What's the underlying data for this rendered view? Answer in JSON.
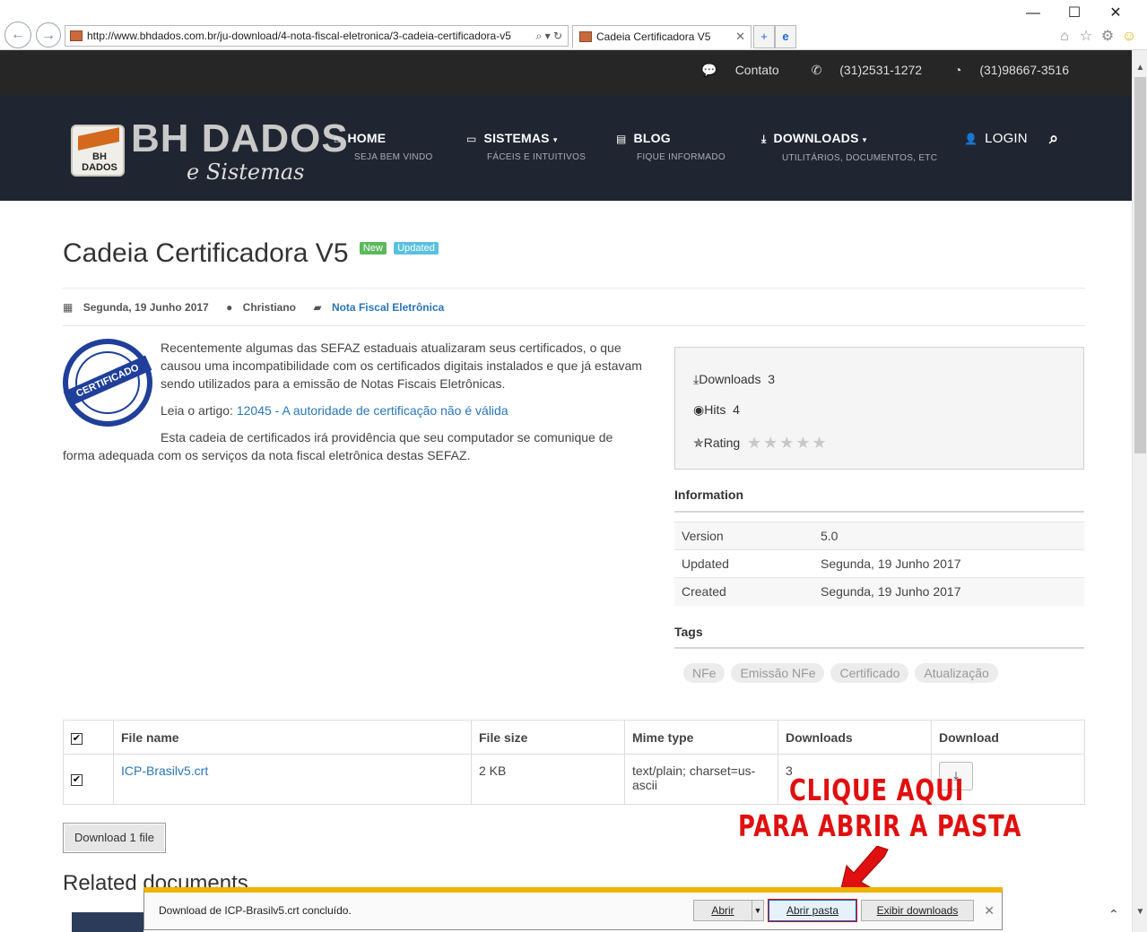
{
  "browser": {
    "url": "http://www.bhdados.com.br/ju-download/4-nota-fiscal-eletronica/3-cadeia-certificadora-v5",
    "tab_title": "Cadeia Certificadora V5",
    "minimize": "—",
    "maximize": "☐",
    "close": "✕"
  },
  "topbar": {
    "contact": "Contato",
    "phone": "(31)2531-1272",
    "whatsapp": "(31)98667-3516"
  },
  "logo": {
    "main": "BH DADOS",
    "sub": "e Sistemas",
    "badge": "BH DADOS"
  },
  "menu": [
    {
      "label": "HOME",
      "sub": "SEJA BEM VINDO",
      "icon": "home-icon"
    },
    {
      "label": "SISTEMAS",
      "sub": "FÁCEIS E INTUITIVOS",
      "icon": "laptop-icon"
    },
    {
      "label": "BLOG",
      "sub": "FIQUE INFORMADO",
      "icon": "newspaper-icon"
    },
    {
      "label": "DOWNLOADS",
      "sub": "UTILITÁRIOS, DOCUMENTOS, ETC",
      "icon": "download-icon"
    },
    {
      "label": "LOGIN",
      "sub": "",
      "icon": "user-icon"
    }
  ],
  "article": {
    "title": "Cadeia Certificadora V5",
    "badge_new": "New",
    "badge_updated": "Updated",
    "date": "Segunda, 19 Junho 2017",
    "author": "Christiano",
    "category": "Nota Fiscal Eletrônica",
    "seal_text": "CERTIFICADO",
    "para1": "Recentemente algumas das SEFAZ estaduais atualizaram seus certificados, o que causou uma incompatibilidade com os certificados digitais instalados e que já estavam sendo utilizados para a emissão de Notas Fiscais Eletrônicas.",
    "para2_prefix": "Leia o artigo: ",
    "para2_link": "12045 - A autoridade de certificação não é válida",
    "para3": "Esta cadeia de certificados irá providência que seu computador se comunique de forma adequada com os serviços da nota fiscal eletrônica destas SEFAZ."
  },
  "stats": {
    "downloads_label": "Downloads",
    "downloads_value": "3",
    "hits_label": "Hits",
    "hits_value": "4",
    "rating_label": "Rating",
    "rating_value": 0,
    "rating_max": 5
  },
  "information": {
    "heading": "Information",
    "rows": [
      {
        "label": "Version",
        "value": "5.0"
      },
      {
        "label": "Updated",
        "value": "Segunda, 19 Junho 2017"
      },
      {
        "label": "Created",
        "value": "Segunda, 19 Junho 2017"
      }
    ]
  },
  "tags": {
    "heading": "Tags",
    "items": [
      "NFe",
      "Emissão NFe",
      "Certificado",
      "Atualização"
    ]
  },
  "files": {
    "headers": [
      "File name",
      "File size",
      "Mime type",
      "Downloads",
      "Download"
    ],
    "rows": [
      {
        "name": "ICP-Brasilv5.crt",
        "size": "2 KB",
        "mime": "text/plain; charset=us-ascii",
        "downloads": "3"
      }
    ],
    "download_all": "Download 1 file"
  },
  "related_heading": "Related documents",
  "annotation": {
    "line1": "CLIQUE AQUI",
    "line2": "PARA ABRIR A PASTA",
    "color": "#e01010"
  },
  "download_bar": {
    "message": "Download de ICP-Brasilv5.crt concluído.",
    "open": "Abrir",
    "open_folder": "Abrir pasta",
    "view_downloads": "Exibir downloads"
  }
}
